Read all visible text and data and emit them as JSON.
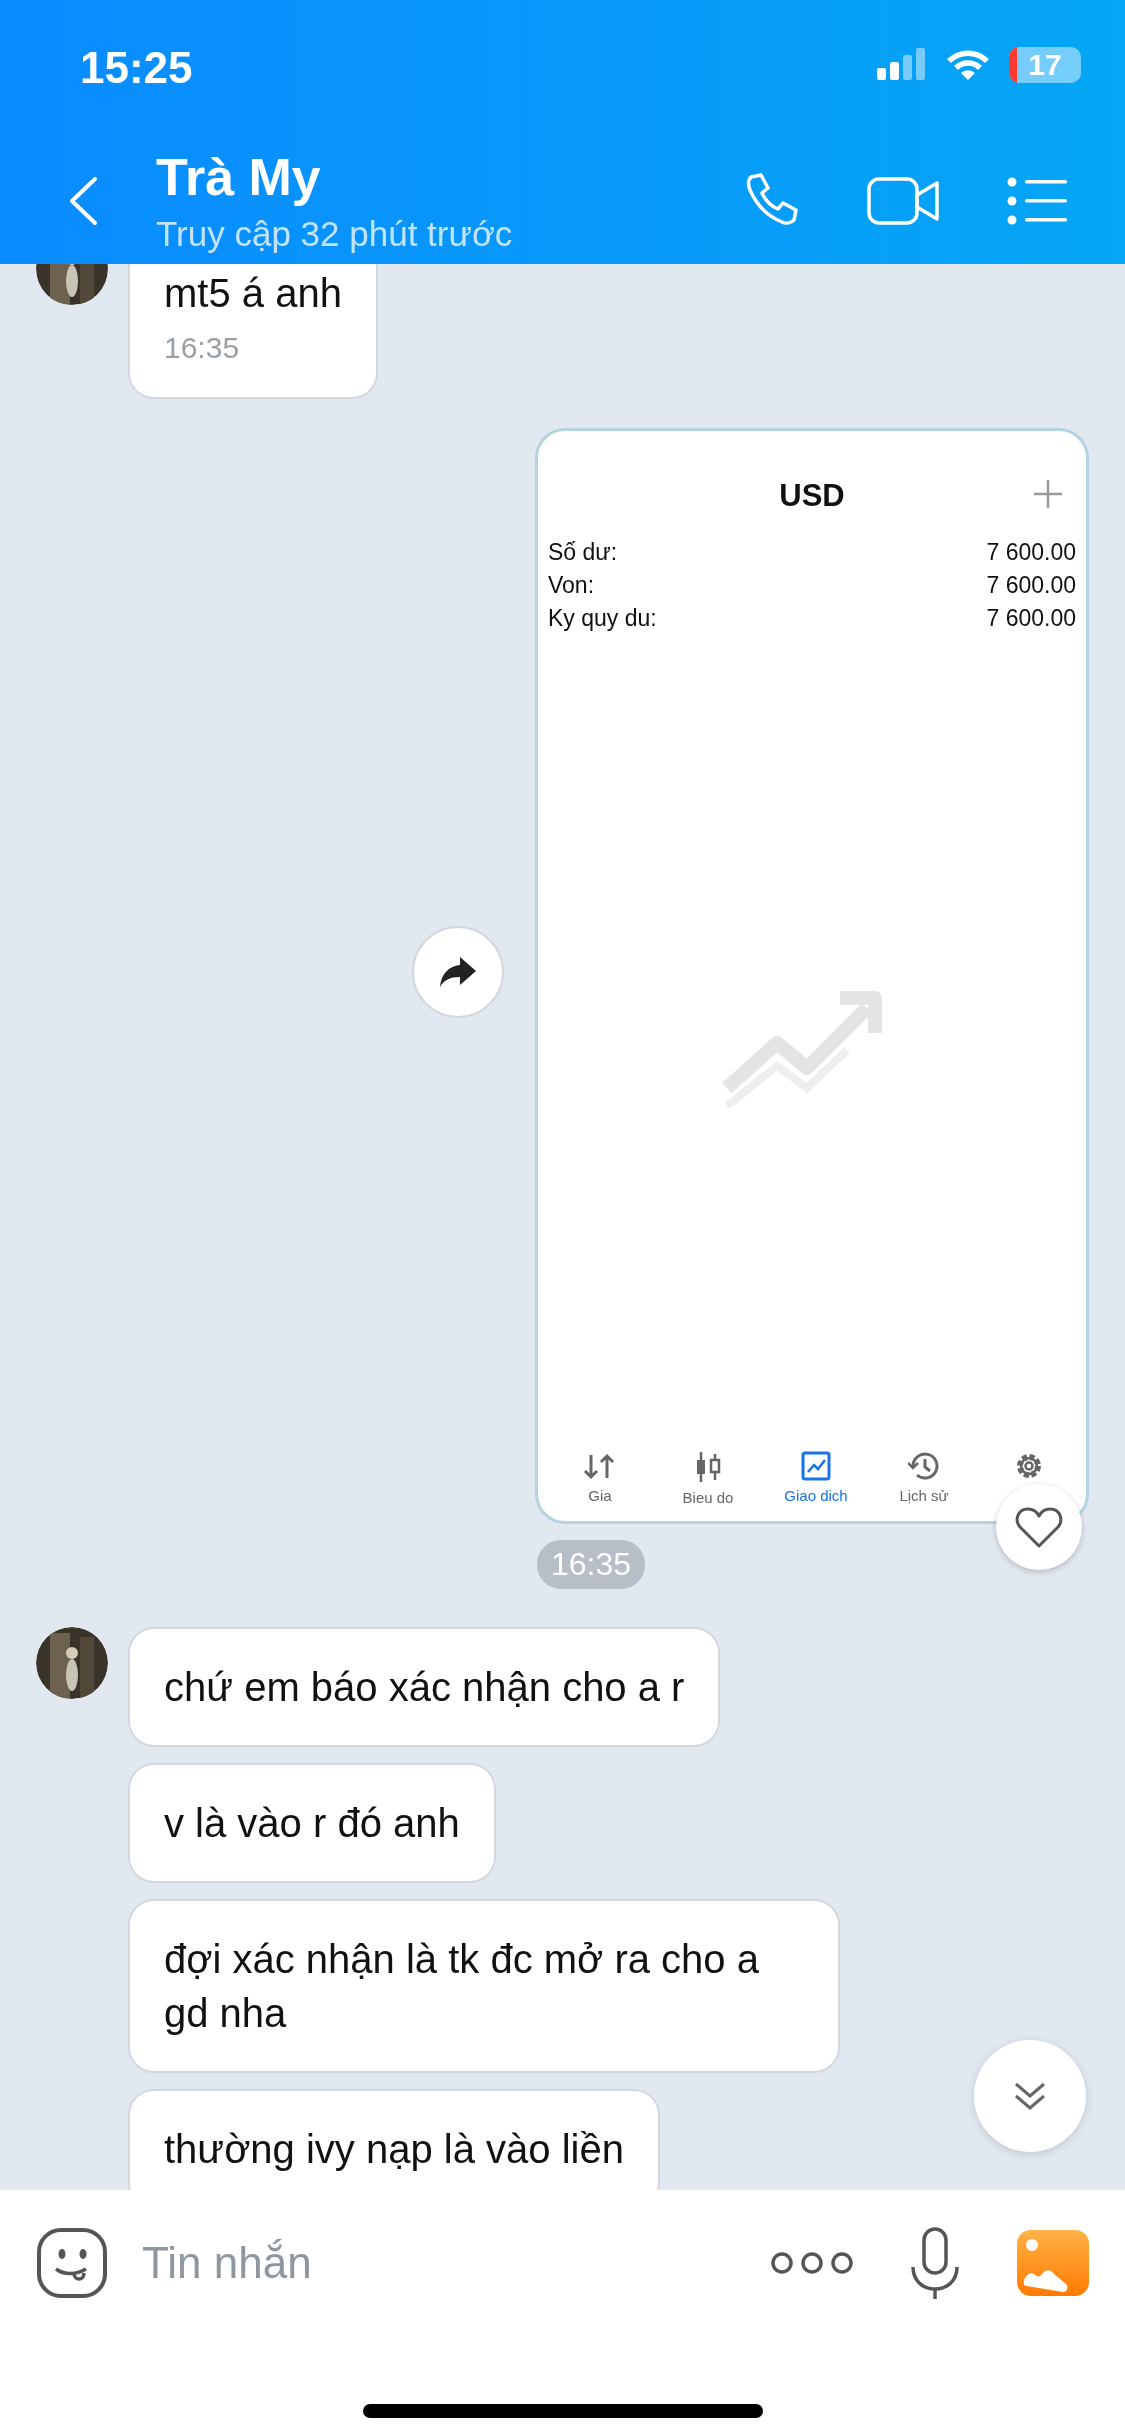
{
  "status_bar": {
    "time": "15:25",
    "battery": "17"
  },
  "header": {
    "title": "Trà My",
    "subtitle": "Truy cập 32 phút trước"
  },
  "messages": [
    {
      "kind": "text",
      "avatar": true,
      "text": "mt5 á anh",
      "time": "16:35"
    },
    {
      "kind": "image",
      "avatar": false,
      "time": "16:35",
      "screen": {
        "title": "USD",
        "rows": [
          {
            "label": "Số dư:",
            "value": "7 600.00"
          },
          {
            "label": "Von:",
            "value": "7 600.00"
          },
          {
            "label": "Ky quy du:",
            "value": "7 600.00"
          }
        ],
        "tabs": [
          {
            "kind": "arrows",
            "label": "Gia",
            "selected": false
          },
          {
            "kind": "candles",
            "label": "Bieu do",
            "selected": false
          },
          {
            "kind": "chart",
            "label": "Giao dich",
            "selected": true
          },
          {
            "kind": "history",
            "label": "Lịch sử",
            "selected": false
          },
          {
            "kind": "gear",
            "selected": false
          }
        ]
      }
    },
    {
      "kind": "text",
      "avatar": true,
      "text": "chứ em báo xác nhận cho a r"
    },
    {
      "kind": "text",
      "avatar": false,
      "text": "v là vào r đó anh"
    },
    {
      "kind": "text",
      "avatar": false,
      "text": "đợi xác nhận là tk đc mở ra cho a gd nha"
    },
    {
      "kind": "text",
      "avatar": false,
      "text": "thường ivy nạp là vào liền"
    }
  ],
  "composer": {
    "placeholder": "Tin nhắn"
  }
}
